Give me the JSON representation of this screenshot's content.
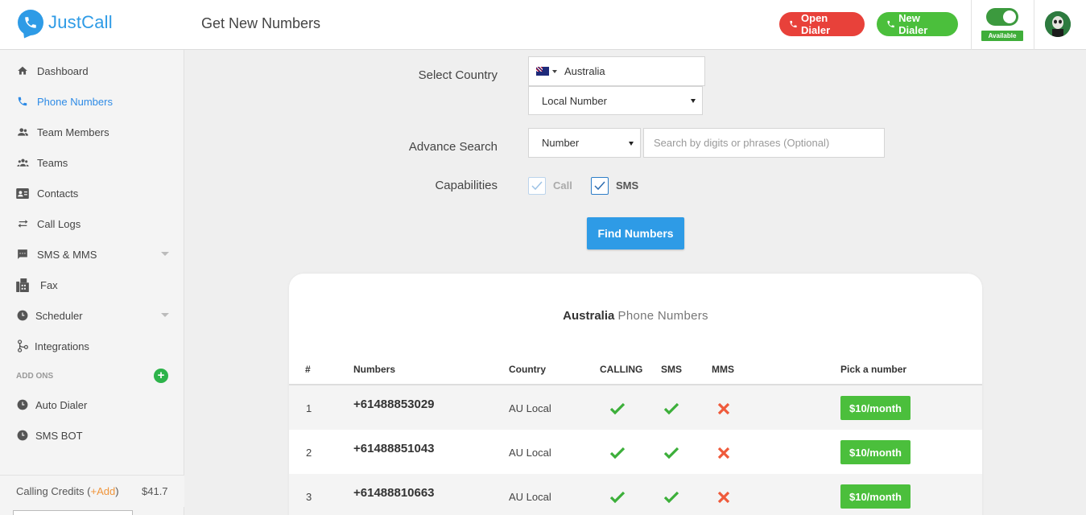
{
  "app": {
    "name": "JustCall"
  },
  "header": {
    "title": "Get New Numbers",
    "open_dialer": "Open Dialer",
    "new_dialer": "New Dialer",
    "status_label": "Available"
  },
  "sidebar": {
    "items": [
      {
        "label": "Dashboard",
        "icon": "home-icon"
      },
      {
        "label": "Phone Numbers",
        "icon": "phone-icon"
      },
      {
        "label": "Team Members",
        "icon": "team-members-icon"
      },
      {
        "label": "Teams",
        "icon": "teams-icon"
      },
      {
        "label": "Contacts",
        "icon": "contacts-icon"
      },
      {
        "label": "Call Logs",
        "icon": "call-logs-icon"
      },
      {
        "label": "SMS & MMS",
        "icon": "sms-icon"
      },
      {
        "label": "Fax",
        "icon": "fax-icon"
      },
      {
        "label": "Scheduler",
        "icon": "clock-icon"
      },
      {
        "label": "Integrations",
        "icon": "integrations-icon"
      }
    ],
    "addons_label": "ADD ONS",
    "addons": [
      {
        "label": "Auto Dialer",
        "icon": "clock-icon"
      },
      {
        "label": "SMS BOT",
        "icon": "clock-icon"
      }
    ],
    "credits_label": "Calling Credits (",
    "credits_add": "+Add",
    "credits_close": ")",
    "credits_value": "$41.7"
  },
  "form": {
    "country_label": "Select Country",
    "country_value": "Australia",
    "number_type": "Local Number",
    "advance_label": "Advance Search",
    "search_by": "Number",
    "search_placeholder": "Search by digits or phrases (Optional)",
    "capabilities_label": "Capabilities",
    "cap_call": "Call",
    "cap_sms": "SMS",
    "find_button": "Find Numbers"
  },
  "results": {
    "title_country": "Australia",
    "title_rest": "Phone Numbers",
    "columns": [
      "#",
      "Numbers",
      "Country",
      "CALLING",
      "SMS",
      "MMS",
      "Pick a number"
    ],
    "rows": [
      {
        "index": "1",
        "number": "+61488853029",
        "country": "AU Local",
        "price": "$10/month"
      },
      {
        "index": "2",
        "number": "+61488851043",
        "country": "AU Local",
        "price": "$10/month"
      },
      {
        "index": "3",
        "number": "+61488810663",
        "country": "AU Local",
        "price": "$10/month"
      }
    ]
  },
  "colors": {
    "brand": "#2e9be6",
    "red": "#e8413a",
    "green": "#4bbf3c",
    "cross": "#ef5a3b"
  }
}
